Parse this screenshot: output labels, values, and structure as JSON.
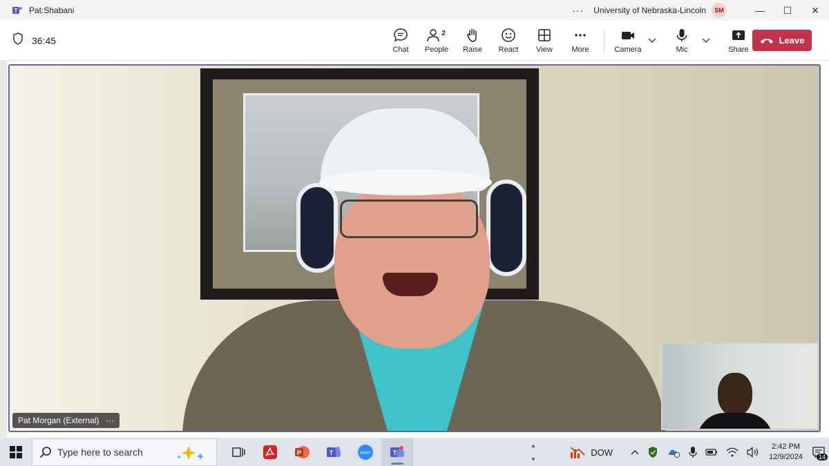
{
  "window": {
    "title": "Pat:Shabani",
    "org": "University of Nebraska-Lincoln",
    "user_initials": "SM"
  },
  "meeting": {
    "timer": "36:45",
    "people_count": "2",
    "toolbar": {
      "chat": "Chat",
      "people": "People",
      "raise": "Raise",
      "react": "React",
      "view": "View",
      "more": "More",
      "camera": "Camera",
      "mic": "Mic",
      "share": "Share",
      "leave": "Leave"
    },
    "main_participant": "Pat Morgan (External)"
  },
  "colors": {
    "accent": "#6264a7",
    "leave": "#c4314b"
  },
  "taskbar": {
    "search_placeholder": "Type here to search",
    "stock_label": "DOW",
    "time": "2:42 PM",
    "date": "12/9/2024",
    "notification_count": "14"
  }
}
